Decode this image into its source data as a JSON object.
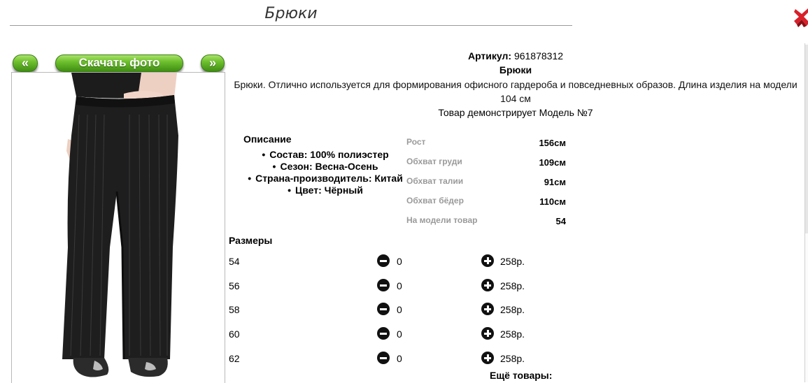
{
  "page": {
    "title": "Брюки"
  },
  "nav": {
    "prev": "«",
    "download": "Скачать фото",
    "next": "»"
  },
  "product": {
    "sku_label": "Артикул:",
    "sku": "961878312",
    "name": "Брюки",
    "description": "Брюки. Отлично используется для формирования офисного гардероба и повседневных образов. Длина изделия на модели 104 см",
    "model_note": "Товар демонстрирует Модель №7"
  },
  "specs": {
    "title": "Описание",
    "items": [
      "Состав: 100% полиэстер",
      "Сезон: Весна-Осень",
      "Страна-производитель: Китай",
      "Цвет: Чёрный"
    ]
  },
  "measurements": [
    {
      "label": "Рост",
      "value": "156см"
    },
    {
      "label": "Обхват груди",
      "value": "109см"
    },
    {
      "label": "Обхват талии",
      "value": "91см"
    },
    {
      "label": "Обхват бёдер",
      "value": "110см"
    },
    {
      "label": "На модели товар",
      "value": "54"
    }
  ],
  "sizes": {
    "title": "Размеры",
    "rows": [
      {
        "size": "54",
        "qty": "0",
        "price": "258р."
      },
      {
        "size": "56",
        "qty": "0",
        "price": "258р."
      },
      {
        "size": "58",
        "qty": "0",
        "price": "258р."
      },
      {
        "size": "60",
        "qty": "0",
        "price": "258р."
      },
      {
        "size": "62",
        "qty": "0",
        "price": "258р."
      }
    ]
  },
  "footer": {
    "more": "Ещё товары:"
  },
  "icons": {
    "close": "close-x-icon",
    "minus": "minus-circle-icon",
    "plus": "plus-circle-icon"
  },
  "colors": {
    "button_green": "#5aae22",
    "close_red": "#d8202a",
    "text_muted": "#9a9a9a"
  }
}
